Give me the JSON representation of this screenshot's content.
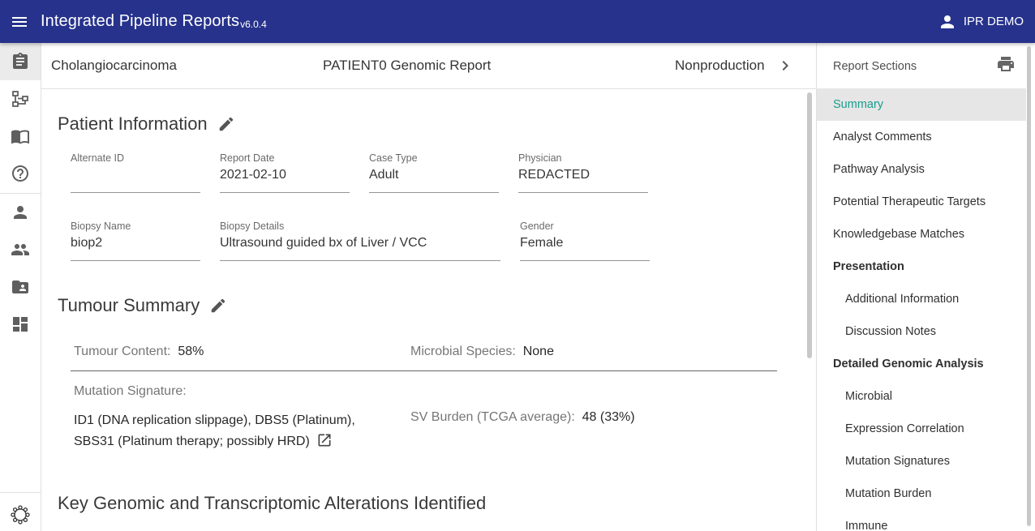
{
  "appbar": {
    "title": "Integrated Pipeline Reports",
    "version": "v6.0.4",
    "user": "IPR DEMO",
    "color": "#26328c"
  },
  "rail": {
    "icons": [
      "report-icon",
      "diagram-icon",
      "book-icon",
      "help-icon",
      "person-icon",
      "people-icon",
      "folder-shared-icon",
      "dashboard-icon",
      "settings-gear-icon"
    ]
  },
  "report_header": {
    "left": "Cholangiocarcinoma",
    "center": "PATIENT0 Genomic Report",
    "right": "Nonproduction"
  },
  "patient_info": {
    "title": "Patient Information",
    "fields": [
      {
        "label": "Alternate ID",
        "value": ""
      },
      {
        "label": "Report Date",
        "value": "2021-02-10"
      },
      {
        "label": "Case Type",
        "value": "Adult"
      },
      {
        "label": "Physician",
        "value": "REDACTED"
      },
      {
        "label": "Biopsy Name",
        "value": "biop2"
      },
      {
        "label": "Biopsy Details",
        "value": "Ultrasound guided bx of Liver / VCC"
      },
      {
        "label": "Gender",
        "value": "Female"
      }
    ]
  },
  "tumour_summary": {
    "title": "Tumour Summary",
    "tumour_content_label": "Tumour Content:",
    "tumour_content_value": "58%",
    "microbial_label": "Microbial Species:",
    "microbial_value": "None",
    "mutation_signature_label": "Mutation Signature:",
    "mutation_signature_line1": "ID1 (DNA replication slippage), DBS5 (Platinum),",
    "mutation_signature_line2": "SBS31 (Platinum therapy; possibly HRD)",
    "sv_burden_label": "SV Burden (TCGA average):",
    "sv_burden_value": "48 (33%)"
  },
  "key_alterations": {
    "title": "Key Genomic and Transcriptomic Alterations Identified"
  },
  "sections_panel": {
    "title": "Report Sections",
    "active_color": "#1a9c8c",
    "items": [
      {
        "label": "Summary",
        "kind": "item",
        "active": true
      },
      {
        "label": "Analyst Comments",
        "kind": "item"
      },
      {
        "label": "Pathway Analysis",
        "kind": "item"
      },
      {
        "label": "Potential Therapeutic Targets",
        "kind": "item"
      },
      {
        "label": "Knowledgebase Matches",
        "kind": "item"
      },
      {
        "label": "Presentation",
        "kind": "group"
      },
      {
        "label": "Additional Information",
        "kind": "sub"
      },
      {
        "label": "Discussion Notes",
        "kind": "sub"
      },
      {
        "label": "Detailed Genomic Analysis",
        "kind": "group"
      },
      {
        "label": "Microbial",
        "kind": "sub"
      },
      {
        "label": "Expression Correlation",
        "kind": "sub"
      },
      {
        "label": "Mutation Signatures",
        "kind": "sub"
      },
      {
        "label": "Mutation Burden",
        "kind": "sub"
      },
      {
        "label": "Immune",
        "kind": "sub"
      }
    ]
  }
}
